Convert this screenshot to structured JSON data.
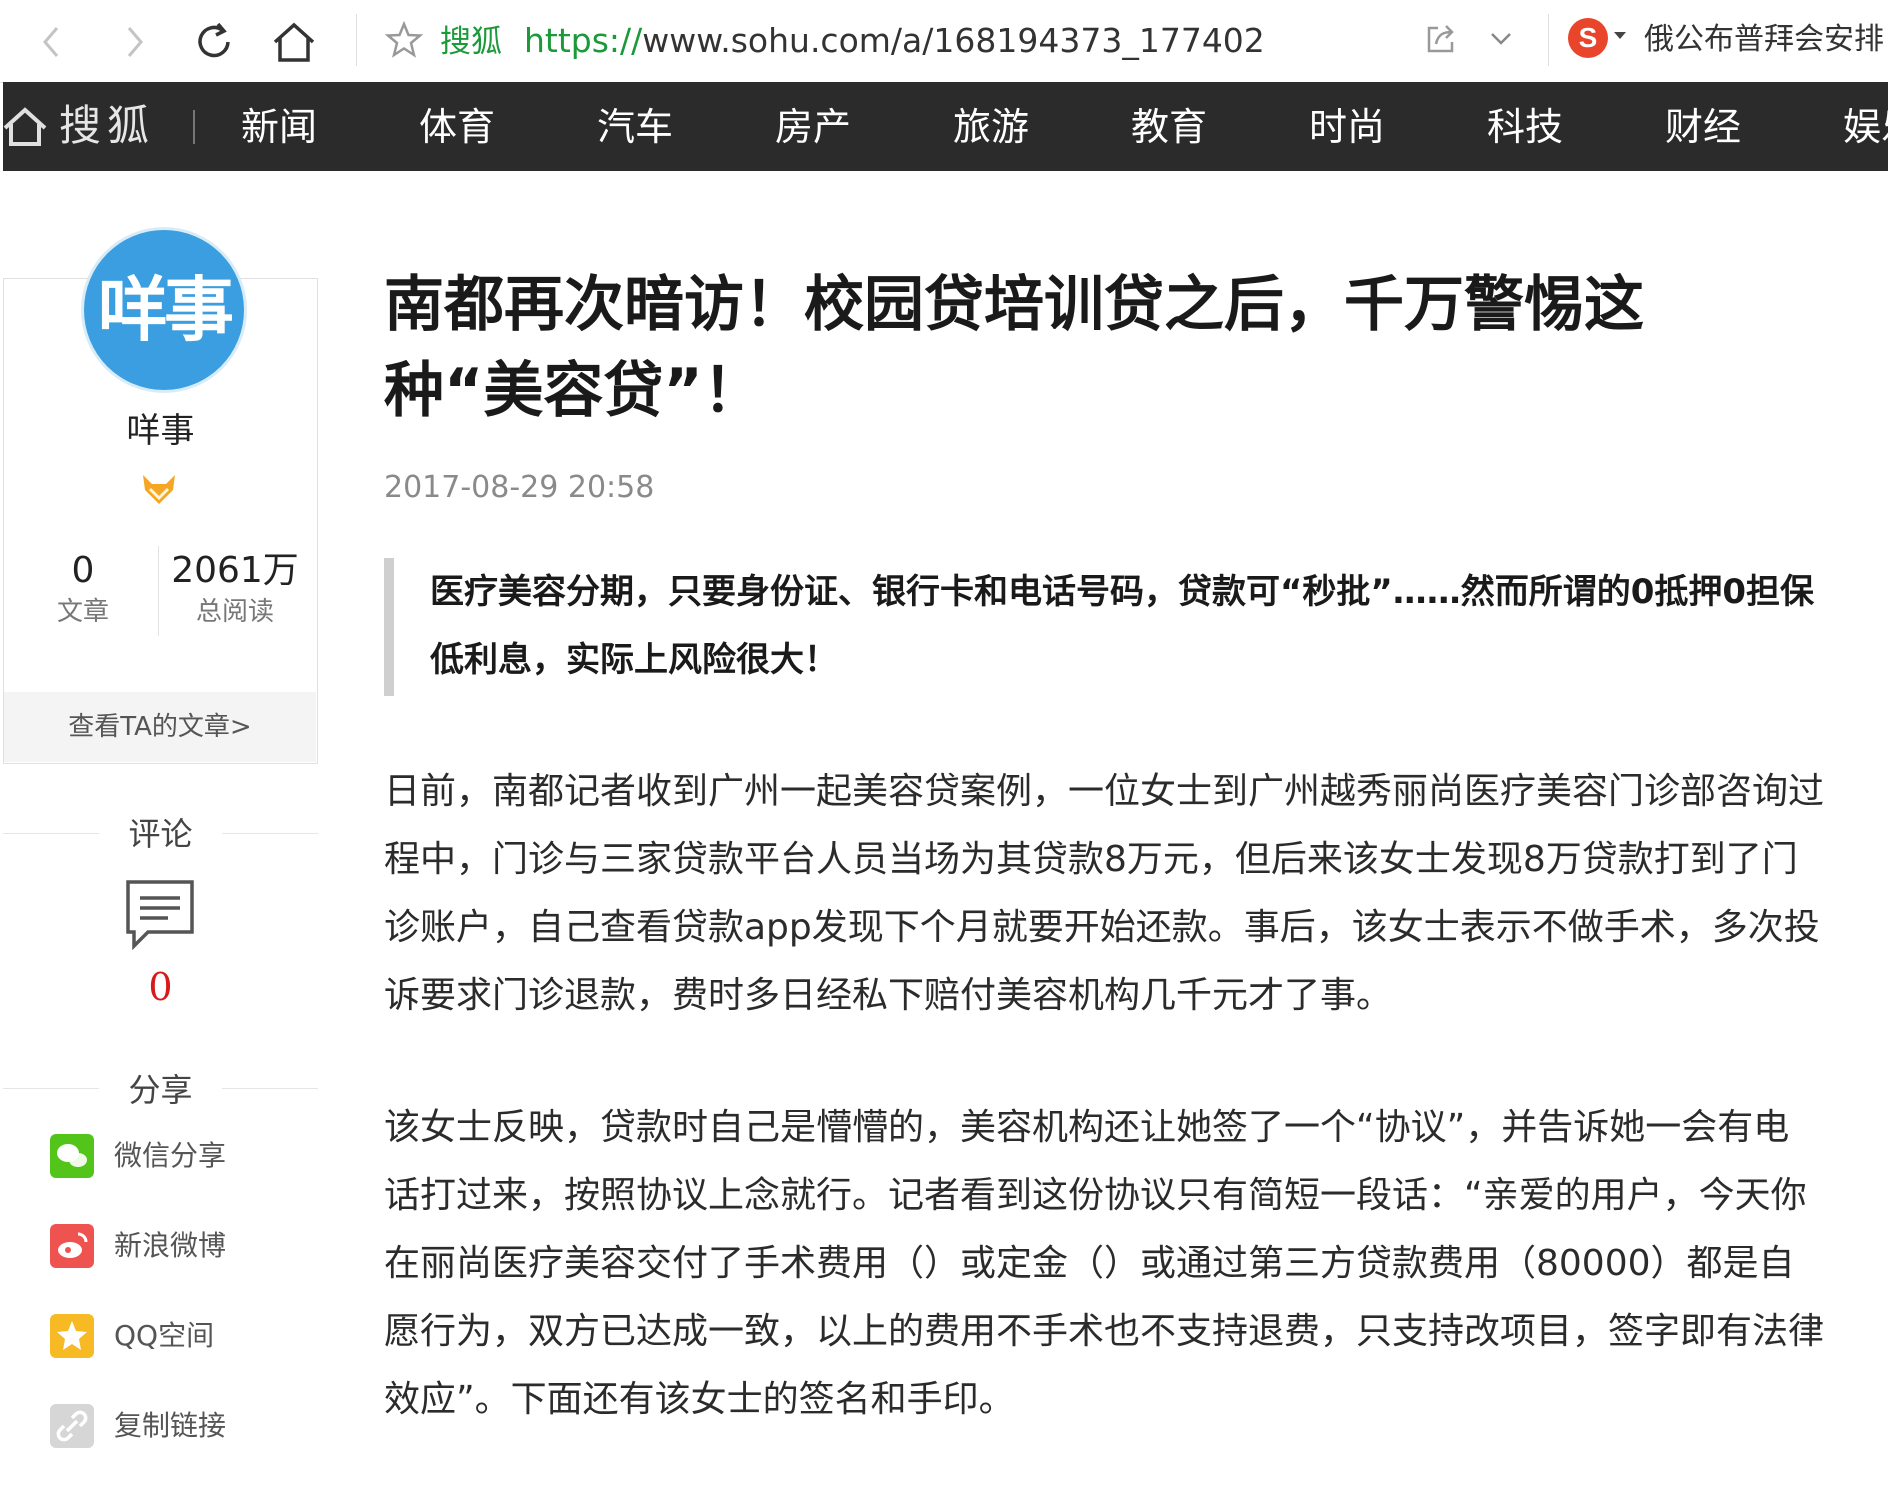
{
  "browser": {
    "site_name": "搜狐",
    "url_scheme": "https://",
    "url_rest": "www.sohu.com/a/168194373_177402",
    "hot_query": "俄公布普拜会安排"
  },
  "site_nav": {
    "logo": "搜狐",
    "items": [
      "新闻",
      "体育",
      "汽车",
      "房产",
      "旅游",
      "教育",
      "时尚",
      "科技",
      "财经",
      "娱乐"
    ]
  },
  "author": {
    "avatar_text": "咩事",
    "name": "咩事",
    "articles_count": "0",
    "articles_label": "文章",
    "reads_count": "2061万",
    "reads_label": "总阅读",
    "view_articles": "查看TA的文章>"
  },
  "comments": {
    "heading": "评论",
    "count": "0"
  },
  "share": {
    "heading": "分享",
    "items": [
      {
        "label": "微信分享",
        "icon": "wechat-icon",
        "color": "#52c41a"
      },
      {
        "label": "新浪微博",
        "icon": "weibo-icon",
        "color": "#ef5350"
      },
      {
        "label": "QQ空间",
        "icon": "qzone-icon",
        "color": "#f7b924"
      },
      {
        "label": "复制链接",
        "icon": "link-icon",
        "color": "#d6d6d6"
      }
    ]
  },
  "article": {
    "title": "南都再次暗访！校园贷培训贷之后，千万警惕这种“美容贷”！",
    "time": "2017-08-29 20:58",
    "lead": "医疗美容分期，只要身份证、银行卡和电话号码，贷款可“秒批”……然而所谓的0抵押0担保低利息，实际上风险很大！",
    "paragraphs": [
      "日前，南都记者收到广州一起美容贷案例，一位女士到广州越秀丽尚医疗美容门诊部咨询过程中，门诊与三家贷款平台人员当场为其贷款8万元，但后来该女士发现8万贷款打到了门诊账户，自己查看贷款app发现下个月就要开始还款。事后，该女士表示不做手术，多次投诉要求门诊退款，费时多日经私下赔付美容机构几千元才了事。",
      "该女士反映，贷款时自己是懵懵的，美容机构还让她签了一个“协议”，并告诉她一会有电话打过来，按照协议上念就行。记者看到这份协议只有简短一段话：“亲爱的用户，今天你在丽尚医疗美容交付了手术费用（）或定金（）或通过第三方贷款费用（80000）都是自愿行为，双方已达成一致，以上的费用不手术也不支持退费，只支持改项目，签字即有法律效应”。下面还有该女士的签名和手印。"
    ]
  }
}
